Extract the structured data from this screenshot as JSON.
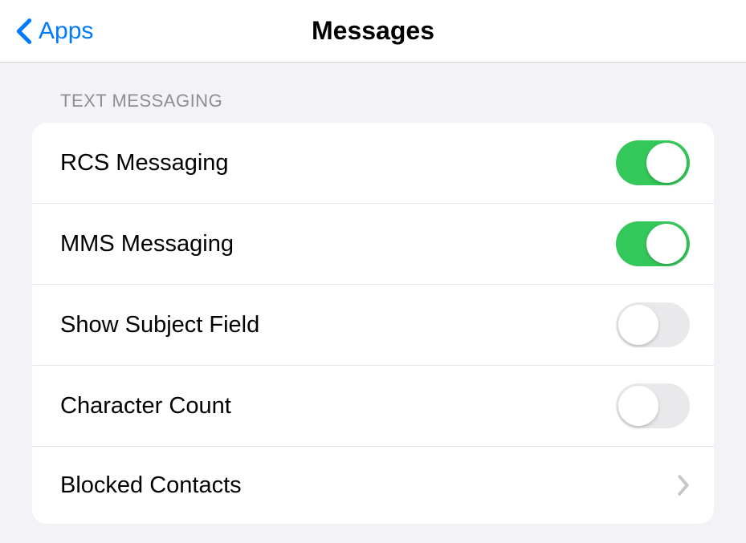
{
  "header": {
    "back_label": "Apps",
    "title": "Messages"
  },
  "section": {
    "header": "TEXT MESSAGING",
    "rows": [
      {
        "label": "RCS Messaging",
        "type": "toggle",
        "value": true
      },
      {
        "label": "MMS Messaging",
        "type": "toggle",
        "value": true
      },
      {
        "label": "Show Subject Field",
        "type": "toggle",
        "value": false
      },
      {
        "label": "Character Count",
        "type": "toggle",
        "value": false
      },
      {
        "label": "Blocked Contacts",
        "type": "disclosure"
      }
    ]
  }
}
